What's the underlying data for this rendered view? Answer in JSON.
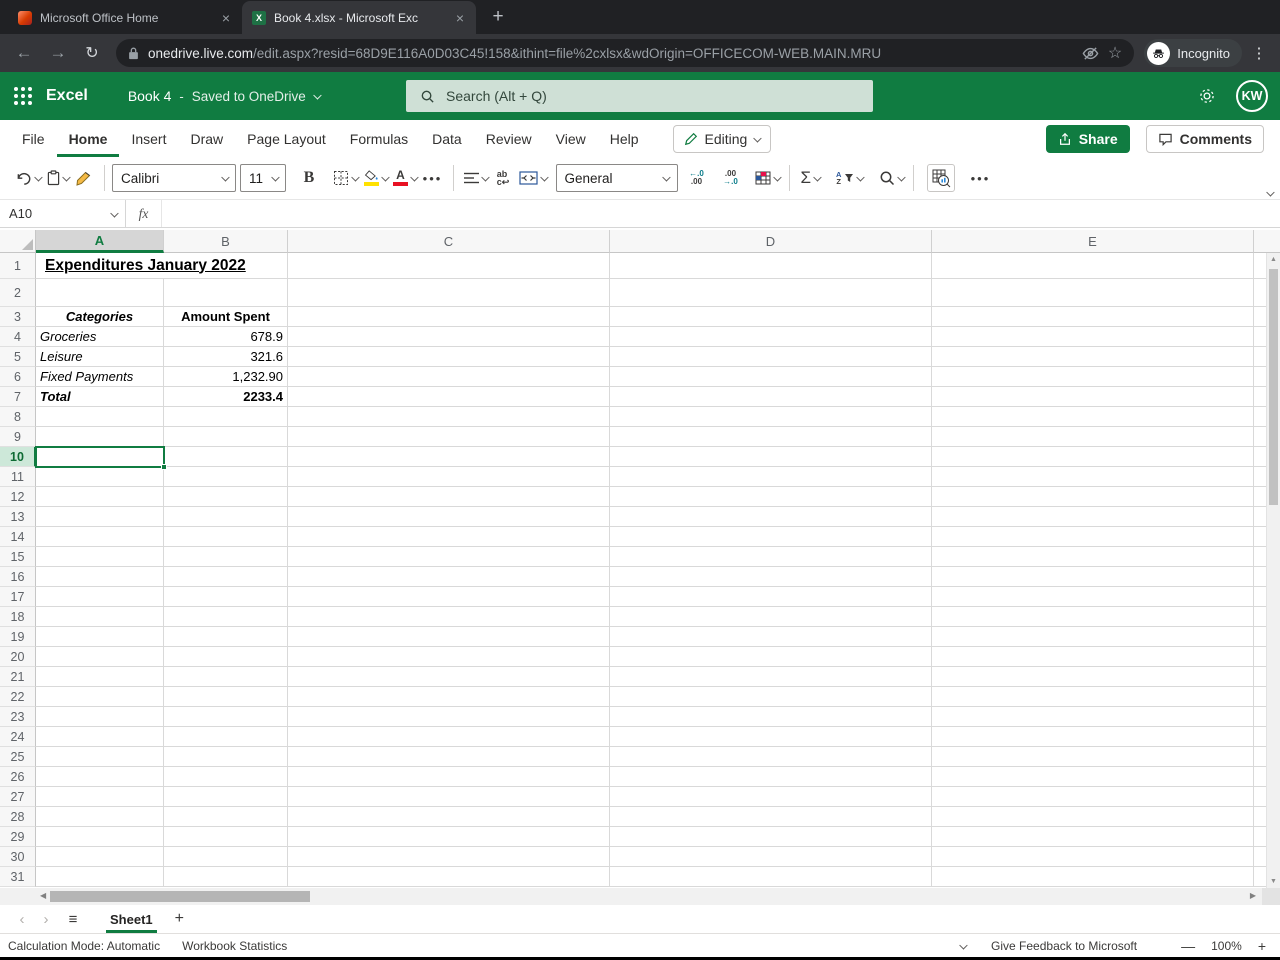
{
  "browser": {
    "tabs": [
      {
        "title": "Microsoft Office Home"
      },
      {
        "title": "Book 4.xlsx - Microsoft Exc"
      }
    ],
    "url_domain": "onedrive.live.com",
    "url_path": "/edit.aspx?resid=68D9E116A0D03C45!158&ithint=file%2cxlsx&wdOrigin=OFFICECOM-WEB.MAIN.MRU",
    "incognito_label": "Incognito"
  },
  "header": {
    "app_name": "Excel",
    "doc_name": "Book 4",
    "doc_sep": "-",
    "doc_status": "Saved to OneDrive",
    "search_placeholder": "Search (Alt + Q)",
    "avatar_initials": "KW"
  },
  "ribbon": {
    "tabs": [
      "File",
      "Home",
      "Insert",
      "Draw",
      "Page Layout",
      "Formulas",
      "Data",
      "Review",
      "View",
      "Help"
    ],
    "active_tab": "Home",
    "editing_label": "Editing",
    "share_label": "Share",
    "comments_label": "Comments"
  },
  "toolbar": {
    "font_name": "Calibri",
    "font_size": "11",
    "bold_label": "B",
    "number_format": "General",
    "dec_decimal": [
      "←.0",
      ".00"
    ],
    "inc_decimal": [
      ".00",
      "→.0"
    ],
    "wrap_glyph": [
      "ab",
      "c↩"
    ],
    "sort_glyph": [
      "A",
      "Z"
    ],
    "sum_label": "Σ",
    "more_label": "•••"
  },
  "formula_bar": {
    "name_box": "A10",
    "fx_label": "fx",
    "formula": ""
  },
  "grid": {
    "columns": [
      "A",
      "B",
      "C",
      "D",
      "E"
    ],
    "row_count": 31,
    "selection": {
      "cell": "A10",
      "column": "A",
      "row": 10
    },
    "cells": {
      "A1": "Expenditures January 2022",
      "A3": "Categories",
      "B3": "Amount Spent",
      "A4": "Groceries",
      "B4": "678.9",
      "A5": "Leisure",
      "B5": "321.6",
      "A6": "Fixed Payments",
      "B6": "1,232.90",
      "A7": "Total",
      "B7": "2233.4"
    },
    "cell_formats": {
      "A1": "title",
      "A3": "center bold italic",
      "B3": "center bold",
      "A4": "italic",
      "B4": "num",
      "A5": "italic",
      "B5": "num",
      "A6": "italic",
      "B6": "num",
      "A7": "bold italic",
      "B7": "num bold"
    }
  },
  "sheet_bar": {
    "sheets": [
      "Sheet1"
    ],
    "active_sheet": "Sheet1"
  },
  "status_bar": {
    "left_items": [
      "Calculation Mode: Automatic",
      "Workbook Statistics"
    ],
    "feedback": "Give Feedback to Microsoft",
    "zoom": "100%",
    "zoom_out": "—",
    "zoom_in": "+"
  }
}
